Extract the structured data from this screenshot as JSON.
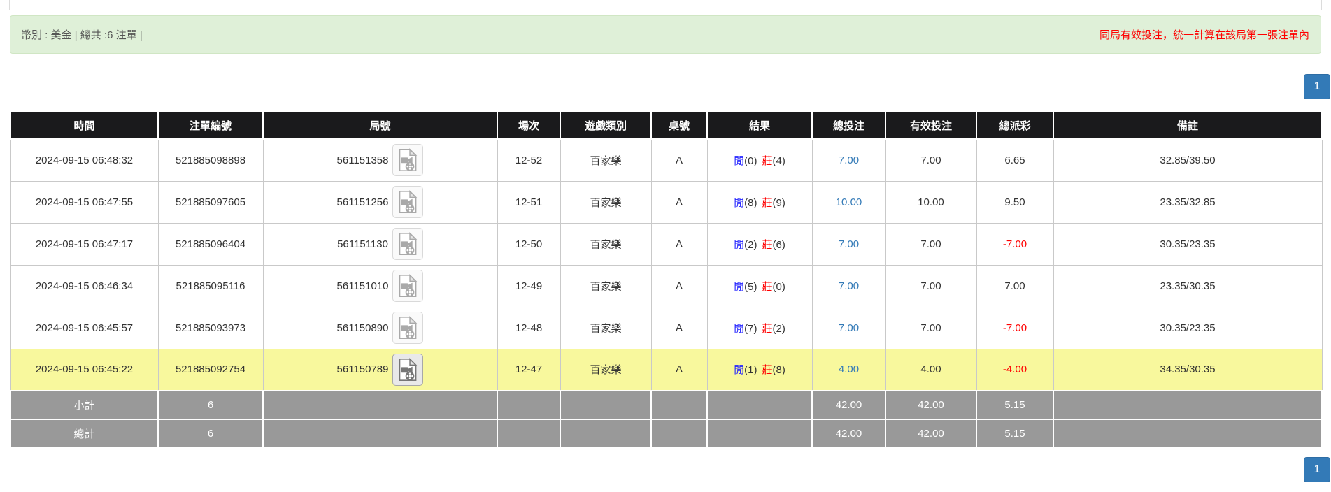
{
  "top_banner": {
    "summary": "幣別 : 美金 | 總共 :6 注單 |",
    "notice": "同局有效投注，統一計算在該局第一張注單內"
  },
  "pagination": {
    "page": "1"
  },
  "table": {
    "headers": {
      "time": "時間",
      "bet_no": "注單編號",
      "round_no": "局號",
      "session": "場次",
      "game_type": "遊戲類別",
      "table_no": "桌號",
      "result": "結果",
      "total_bet": "總投注",
      "valid_bet": "有效投注",
      "total_payout": "總派彩",
      "remark": "備註"
    },
    "rows": [
      {
        "time": "2024-09-15 06:48:32",
        "bet_no": "521885098898",
        "round_no": "561151358",
        "session": "12-52",
        "game_type": "百家樂",
        "table_no": "A",
        "result": {
          "p": "閒",
          "pv": "(0)",
          "b": "莊",
          "bv": "(4)"
        },
        "total_bet": "7.00",
        "valid_bet": "7.00",
        "total_payout": "6.65",
        "remark": "32.85/39.50"
      },
      {
        "time": "2024-09-15 06:47:55",
        "bet_no": "521885097605",
        "round_no": "561151256",
        "session": "12-51",
        "game_type": "百家樂",
        "table_no": "A",
        "result": {
          "p": "閒",
          "pv": "(8)",
          "b": "莊",
          "bv": "(9)"
        },
        "total_bet": "10.00",
        "valid_bet": "10.00",
        "total_payout": "9.50",
        "remark": "23.35/32.85"
      },
      {
        "time": "2024-09-15 06:47:17",
        "bet_no": "521885096404",
        "round_no": "561151130",
        "session": "12-50",
        "game_type": "百家樂",
        "table_no": "A",
        "result": {
          "p": "閒",
          "pv": "(2)",
          "b": "莊",
          "bv": "(6)"
        },
        "total_bet": "7.00",
        "valid_bet": "7.00",
        "total_payout": "-7.00",
        "remark": "30.35/23.35"
      },
      {
        "time": "2024-09-15 06:46:34",
        "bet_no": "521885095116",
        "round_no": "561151010",
        "session": "12-49",
        "game_type": "百家樂",
        "table_no": "A",
        "result": {
          "p": "閒",
          "pv": "(5)",
          "b": "莊",
          "bv": "(0)"
        },
        "total_bet": "7.00",
        "valid_bet": "7.00",
        "total_payout": "7.00",
        "remark": "23.35/30.35"
      },
      {
        "time": "2024-09-15 06:45:57",
        "bet_no": "521885093973",
        "round_no": "561150890",
        "session": "12-48",
        "game_type": "百家樂",
        "table_no": "A",
        "result": {
          "p": "閒",
          "pv": "(7)",
          "b": "莊",
          "bv": "(2)"
        },
        "total_bet": "7.00",
        "valid_bet": "7.00",
        "total_payout": "-7.00",
        "remark": "30.35/23.35"
      },
      {
        "time": "2024-09-15 06:45:22",
        "bet_no": "521885092754",
        "round_no": "561150789",
        "session": "12-47",
        "game_type": "百家樂",
        "table_no": "A",
        "result": {
          "p": "閒",
          "pv": "(1)",
          "b": "莊",
          "bv": "(8)"
        },
        "total_bet": "4.00",
        "valid_bet": "4.00",
        "total_payout": "-4.00",
        "remark": "34.35/30.35"
      }
    ],
    "subtotal": {
      "label": "小計",
      "count": "6",
      "total_bet": "42.00",
      "valid_bet": "42.00",
      "total_payout": "5.15"
    },
    "grand_total": {
      "label": "總計",
      "count": "6",
      "total_bet": "42.00",
      "valid_bet": "42.00",
      "total_payout": "5.15"
    }
  },
  "colors": {
    "header_bg": "#1a1a1c",
    "highlight_row": "#f8f89d",
    "summary_row_bg": "#999999",
    "banner_bg": "#dff0d8",
    "notice_red": "#ff0000",
    "player_blue": "#2222ff",
    "banker_red": "#ff0000",
    "link_blue": "#337ab7",
    "pager_blue": "#337ab7"
  }
}
